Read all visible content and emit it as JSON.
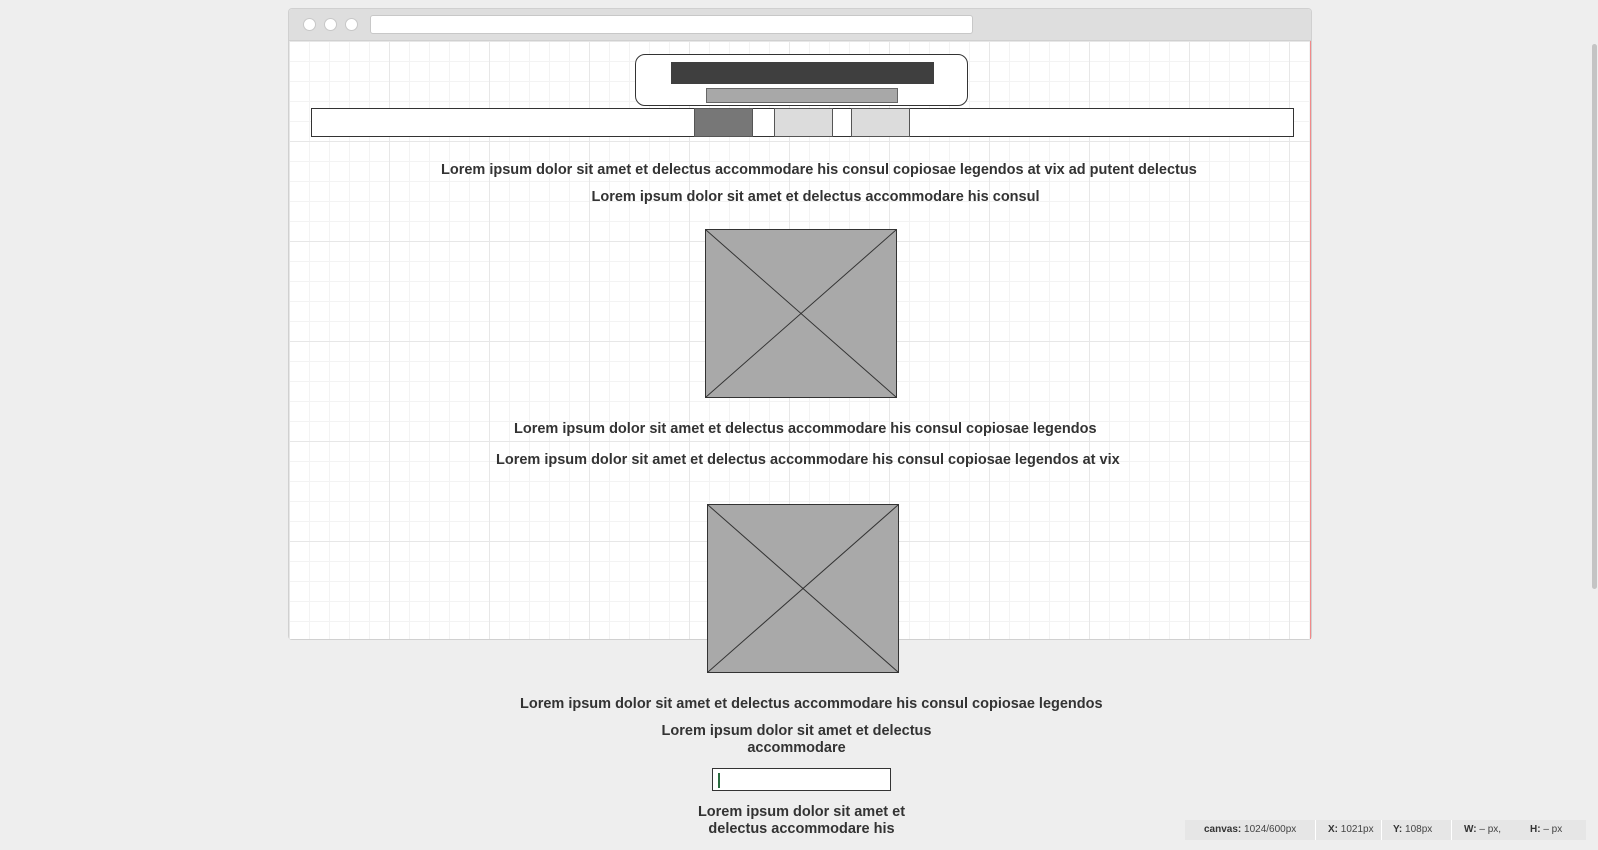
{
  "canvas_texts": {
    "line1": "Lorem ipsum dolor sit amet et delectus accommodare his consul copiosae legendos at vix ad putent delectus",
    "line2": "Lorem ipsum dolor sit amet et delectus accommodare his consul",
    "line3": "Lorem ipsum dolor sit amet et delectus accommodare his consul copiosae legendos",
    "line4": "Lorem ipsum dolor sit amet et delectus accommodare his consul copiosae legendos at vix",
    "line5": "Lorem ipsum dolor sit amet et delectus accommodare his consul copiosae legendos",
    "line6": "Lorem ipsum dolor sit amet et delectus accommodare",
    "line7": "Lorem ipsum dolor sit amet et delectus accommodare his"
  },
  "text_input": {
    "value": ""
  },
  "status_bar": {
    "canvas_label": "canvas:",
    "canvas_value": "1024/600px",
    "x_label": "X:",
    "x_value": "1021px",
    "y_label": "Y:",
    "y_value": "108px",
    "w_label": "W:",
    "w_value": "– px,",
    "h_label": "H:",
    "h_value": "– px"
  },
  "colors": {
    "workspace_bg": "#eeeeee",
    "title_bar": "#3f3f3f",
    "placeholder_fill": "#a9a9a9",
    "active_tab": "#777777",
    "inactive_tab": "#dcdcdc",
    "canvas_edge": "#f08a8a"
  }
}
